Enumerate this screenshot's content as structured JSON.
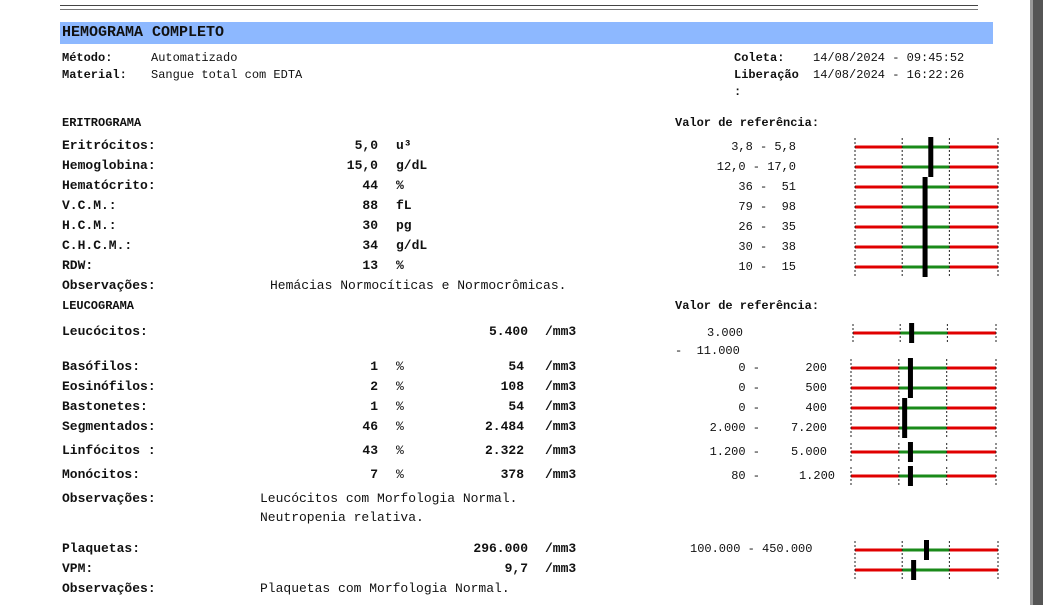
{
  "title": "HEMOGRAMA COMPLETO",
  "header": {
    "metodo_label": "Método:",
    "metodo_value": "Automatizado",
    "material_label": "Material:",
    "material_value": "Sangue total com EDTA",
    "coleta_label": "Coleta:",
    "coleta_value": "14/08/2024 - 09:45:52",
    "liberacao_label": "Liberação",
    "liberacao_value": "14/08/2024 - 16:22:26",
    "liberacao_colon": ":"
  },
  "eritrograma": {
    "title": "ERITROGRAMA",
    "ref_title": "Valor de referência:",
    "rows": [
      {
        "name": "Eritrócitos:",
        "value": "5,0",
        "unit": "u³",
        "ref": "3,8 - 5,8",
        "level": 0.53
      },
      {
        "name": "Hemoglobina:",
        "value": "15,0",
        "unit": "g/dL",
        "ref": "12,0 - 17,0",
        "level": 0.53
      },
      {
        "name": "Hematócrito:",
        "value": "44",
        "unit": "%",
        "ref": "36 -  51",
        "level": 0.49
      },
      {
        "name": "V.C.M.:",
        "value": "88",
        "unit": "fL",
        "ref": "79 -  98",
        "level": 0.49
      },
      {
        "name": "H.C.M.:",
        "value": "30",
        "pg_unit": "",
        "unit": "pg",
        "ref": "26 -  35",
        "level": 0.49
      },
      {
        "name": "C.H.C.M.:",
        "value": "34",
        "unit": "g/dL",
        "ref": "30 -  38",
        "level": 0.49
      },
      {
        "name": "RDW:",
        "value": "13",
        "unit": "%",
        "ref": "10 -  15",
        "level": 0.49
      }
    ],
    "obs_label": "Observações:",
    "obs_text": "Hemácias Normocíticas e Normocrômicas."
  },
  "leucograma": {
    "title": "LEUCOGRAMA",
    "ref_title": "Valor de referência:",
    "leucocitos": {
      "name": "Leucócitos:",
      "abs": "5.400",
      "unit": "/mm3",
      "ref_line1": "3.000",
      "ref_line2": "-  11.000",
      "level": 0.41
    },
    "rows": [
      {
        "name": "Basófilos:",
        "pct": "1",
        "pct_unit": "%",
        "abs": "54",
        "unit": "/mm3",
        "ref_low": "0 -",
        "ref_high": "200",
        "level": 0.41
      },
      {
        "name": "Eosinófilos:",
        "pct": "2",
        "pct_unit": "%",
        "abs": "108",
        "unit": "/mm3",
        "ref_low": "0 -",
        "ref_high": "500",
        "level": 0.41
      },
      {
        "name": "Bastonetes:",
        "pct": "1",
        "pct_unit": "%",
        "abs": "54",
        "unit": "/mm3",
        "ref_low": "0 -",
        "ref_high": "400",
        "level": 0.37
      },
      {
        "name": "Segmentados:",
        "pct": "46",
        "pct_unit": "%",
        "abs": "2.484",
        "unit": "/mm3",
        "ref_low": "2.000 -",
        "ref_high": "7.200",
        "level": 0.37
      },
      {
        "name": "Linfócitos :",
        "pct": "43",
        "pct_unit": "%",
        "abs": "2.322",
        "unit": "/mm3",
        "ref_low": "1.200 -",
        "ref_high": "5.000",
        "level": 0.41
      },
      {
        "name": "Monócitos:",
        "pct": "7",
        "pct_unit": "%",
        "abs": "378",
        "unit": "/mm3",
        "ref_low": "80 -",
        "ref_high": "1.200",
        "level": 0.41
      }
    ],
    "obs_label": "Observações:",
    "obs_line1": "Leucócitos com Morfologia Normal.",
    "obs_line2": "Neutropenia relativa."
  },
  "plaquetas": {
    "rows": [
      {
        "name": "Plaquetas:",
        "value": "296.000",
        "unit": "/mm3",
        "ref": "100.000 - 450.000",
        "level": 0.5
      },
      {
        "name": "VPM:",
        "value": "9,7",
        "unit": "/mm3",
        "ref": "",
        "level": 0.41
      }
    ],
    "obs_label": "Observações:",
    "obs_text": "Plaquetas com Morfologia Normal."
  },
  "colors": {
    "header_bar": "#8db8ff",
    "low_high": "#e00000",
    "normal": "#1a8a1a",
    "marker": "#000000"
  }
}
